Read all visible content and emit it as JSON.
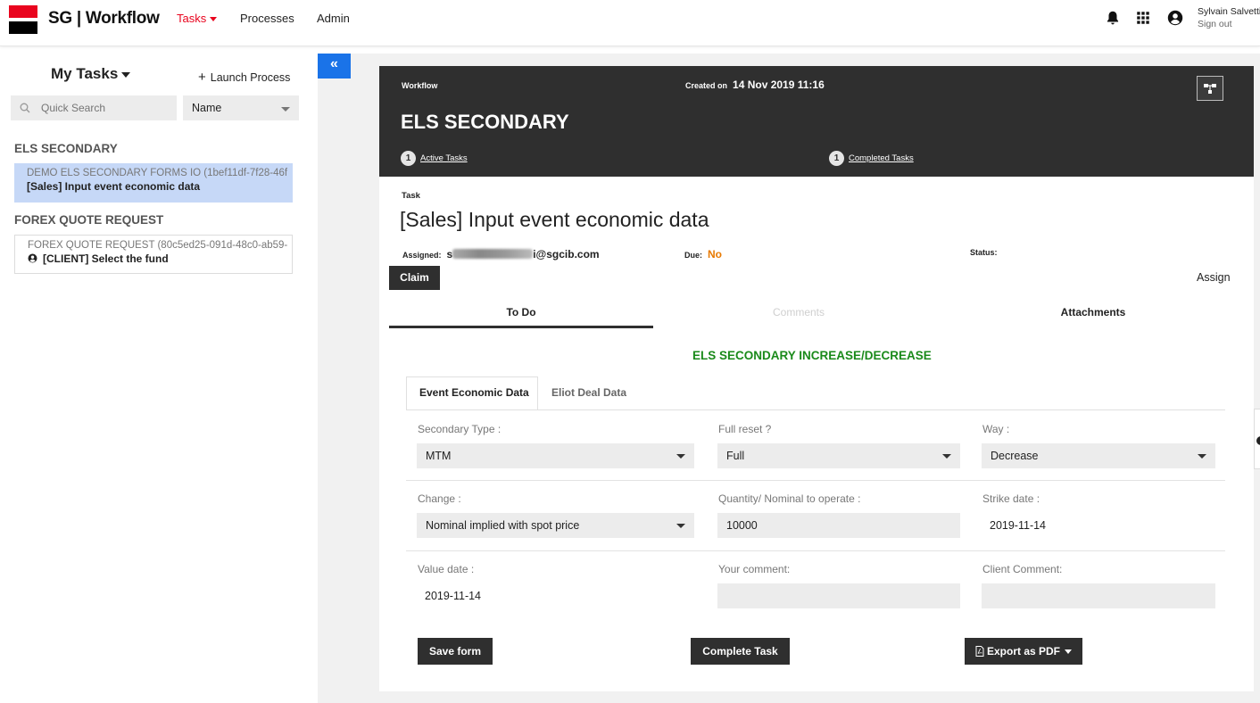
{
  "header": {
    "brand": "SG | Workflow",
    "nav": {
      "tasks": "Tasks",
      "processes": "Processes",
      "admin": "Admin"
    },
    "icons": [
      "bell-icon",
      "apps-grid-icon",
      "user-circle-icon"
    ],
    "user": {
      "name": "Sylvain Salvetti",
      "signout": "Sign out"
    },
    "colors": {
      "brand_red": "#e9041e",
      "accent_blue": "#1a73e8"
    }
  },
  "sidebar": {
    "title": "My Tasks",
    "launch_label": "Launch Process",
    "search_placeholder": "Quick Search",
    "sort_value": "Name",
    "groups": [
      {
        "title": "ELS SECONDARY",
        "items": [
          {
            "sub": "DEMO ELS SECONDARY FORMS IO (1bef11df-7f28-46f",
            "name": "[Sales] Input event economic data"
          }
        ]
      },
      {
        "title": "FOREX QUOTE REQUEST",
        "items": [
          {
            "sub": "FOREX QUOTE REQUEST  (80c5ed25-091d-48c0-ab59-",
            "name": "[CLIENT] Select the fund"
          }
        ]
      }
    ]
  },
  "workflow": {
    "label": "Workflow",
    "created_label": "Created on",
    "created_value": "14 Nov 2019 11:16",
    "title": "ELS SECONDARY",
    "active_count": "1",
    "active_label": "Active Tasks",
    "completed_count": "1",
    "completed_label": "Completed Tasks"
  },
  "task": {
    "label": "Task",
    "title": "[Sales] Input event economic data",
    "assigned_label": "Assigned:",
    "assigned_prefix": "s",
    "assigned_suffix": "i@sgcib.com",
    "due_label": "Due:",
    "due_value": "No",
    "status_label": "Status:",
    "claim": "Claim",
    "assign": "Assign"
  },
  "tabs": {
    "todo": "To Do",
    "comments": "Comments",
    "attachments": "Attachments"
  },
  "form": {
    "title": "ELS SECONDARY INCREASE/DECREASE",
    "subtabs": {
      "economic": "Event Economic Data",
      "eliot": "Eliot Deal Data"
    },
    "fields": {
      "secondary_type": {
        "label": "Secondary Type :",
        "value": "MTM"
      },
      "full_reset": {
        "label": "Full reset ?",
        "value": "Full"
      },
      "way": {
        "label": "Way :",
        "value": "Decrease"
      },
      "change": {
        "label": "Change :",
        "value": "Nominal implied with spot price"
      },
      "quantity": {
        "label": "Quantity/ Nominal to operate :",
        "value": "10000"
      },
      "strike_date": {
        "label": "Strike date :",
        "value": "2019-11-14"
      },
      "value_date": {
        "label": "Value date :",
        "value": "2019-11-14"
      },
      "your_comment": {
        "label": "Your comment:",
        "value": ""
      },
      "client_comment": {
        "label": "Client Comment:",
        "value": ""
      }
    },
    "buttons": {
      "save": "Save form",
      "complete": "Complete Task",
      "export": "Export as PDF"
    }
  }
}
